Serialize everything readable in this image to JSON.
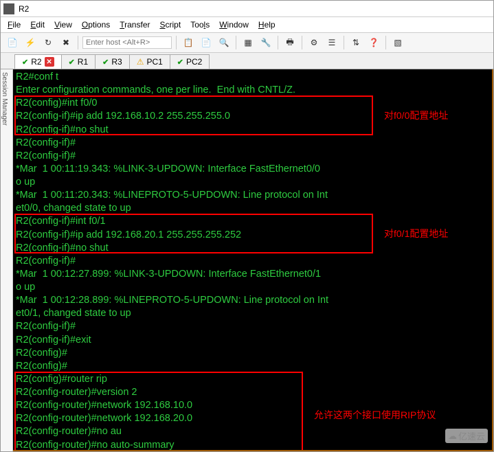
{
  "window": {
    "title": "R2"
  },
  "menu": {
    "file": "File",
    "edit": "Edit",
    "view": "View",
    "options": "Options",
    "transfer": "Transfer",
    "script": "Script",
    "tools": "Tools",
    "window": "Window",
    "help": "Help"
  },
  "toolbar": {
    "host_placeholder": "Enter host <Alt+R>"
  },
  "tabs": [
    {
      "name": "R2",
      "status": "ok",
      "closable": true
    },
    {
      "name": "R1",
      "status": "ok",
      "closable": false
    },
    {
      "name": "R3",
      "status": "ok",
      "closable": false
    },
    {
      "name": "PC1",
      "status": "warn",
      "closable": false
    },
    {
      "name": "PC2",
      "status": "ok",
      "closable": false
    }
  ],
  "session_manager_label": "Session Manager",
  "terminal": {
    "lines": [
      "R2#conf t",
      "Enter configuration commands, one per line.  End with CNTL/Z.",
      "R2(config)#int f0/0",
      "R2(config-if)#ip add 192.168.10.2 255.255.255.0",
      "R2(config-if)#no shut",
      "R2(config-if)#",
      "R2(config-if)#",
      "*Mar  1 00:11:19.343: %LINK-3-UPDOWN: Interface FastEthernet0/0",
      "o up",
      "*Mar  1 00:11:20.343: %LINEPROTO-5-UPDOWN: Line protocol on Int",
      "et0/0, changed state to up",
      "R2(config-if)#int f0/1",
      "R2(config-if)#ip add 192.168.20.1 255.255.255.252",
      "R2(config-if)#no shut",
      "R2(config-if)#",
      "*Mar  1 00:12:27.899: %LINK-3-UPDOWN: Interface FastEthernet0/1",
      "o up",
      "*Mar  1 00:12:28.899: %LINEPROTO-5-UPDOWN: Line protocol on Int",
      "et0/1, changed state to up",
      "R2(config-if)#",
      "R2(config-if)#exit",
      "R2(config)#",
      "R2(config)#",
      "R2(config)#router rip",
      "R2(config-router)#version 2",
      "R2(config-router)#network 192.168.10.0",
      "R2(config-router)#network 192.168.20.0",
      "R2(config-router)#no au",
      "R2(config-router)#no auto-summary"
    ]
  },
  "annotations": {
    "box1_label": "对f0/0配置地址",
    "box2_label": "对f0/1配置地址",
    "box3_label": "允许这两个接口使用RIP协议"
  },
  "watermark": "亿速云"
}
